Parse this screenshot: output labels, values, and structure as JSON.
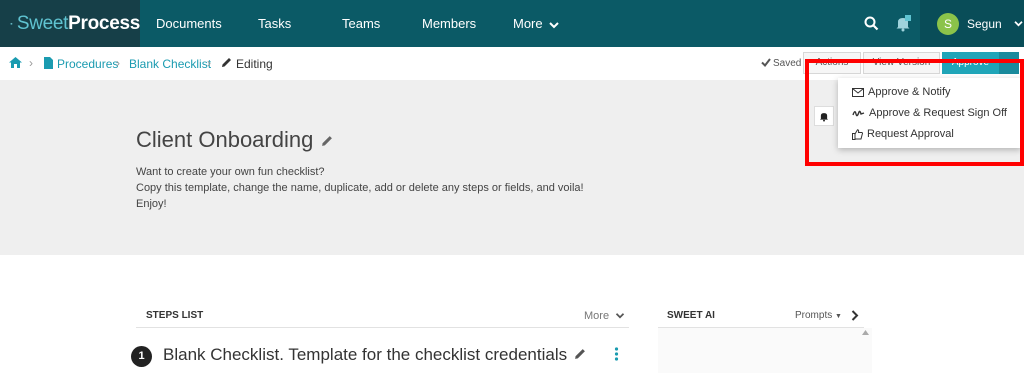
{
  "app": {
    "logo_part1": "Sweet",
    "logo_part2": "Process"
  },
  "nav": {
    "items": [
      "Documents",
      "Tasks",
      "Teams",
      "Members"
    ],
    "more": "More",
    "user": {
      "initial": "S",
      "name": "Segun"
    }
  },
  "breadcrumb": {
    "items": [
      "Procedures",
      "Blank Checklist"
    ],
    "current": "Editing"
  },
  "toolbar": {
    "saved": "Saved",
    "actions": "Actions",
    "view_version": "View Version",
    "approve": "Approve"
  },
  "dropdown": {
    "items": [
      "Approve & Notify",
      "Approve & Request Sign Off",
      "Request Approval"
    ]
  },
  "document": {
    "title": "Client Onboarding",
    "description": [
      "Want to create your own fun checklist?",
      "Copy this template, change the name, duplicate, add or delete any steps or fields, and voila!",
      "Enjoy!"
    ]
  },
  "steps": {
    "header": "STEPS LIST",
    "more": "More",
    "first_step_number": "1",
    "first_step_title": "Blank Checklist. Template for the checklist credentials"
  },
  "sweet_ai": {
    "header": "SWEET AI",
    "prompts": "Prompts"
  },
  "colors": {
    "nav_bg": "#0b5a66",
    "accent": "#20a5b8",
    "highlight": "#ff0000"
  }
}
